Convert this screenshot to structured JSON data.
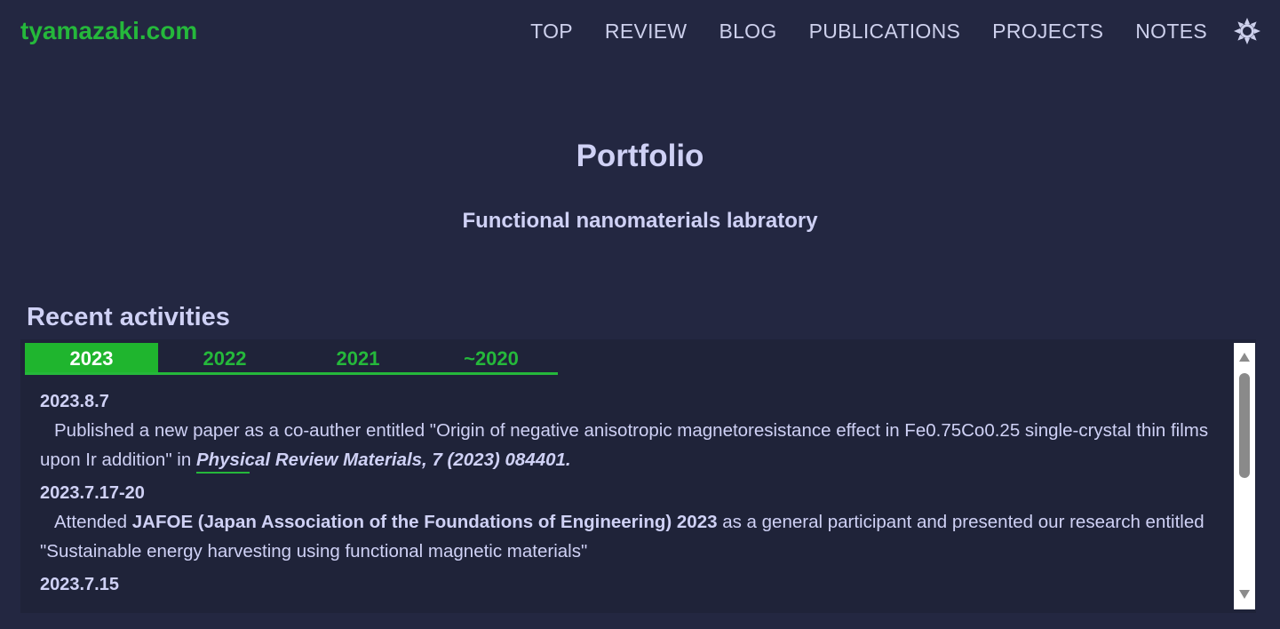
{
  "header": {
    "brand": "tyamazaki.com",
    "nav": [
      "TOP",
      "REVIEW",
      "BLOG",
      "PUBLICATIONS",
      "PROJECTS",
      "NOTES"
    ],
    "theme_icon": "sun-icon"
  },
  "hero": {
    "title": "Portfolio",
    "subtitle": "Functional nanomaterials labratory"
  },
  "activities": {
    "title": "Recent activities",
    "tabs": [
      "2023",
      "2022",
      "2021",
      "~2020"
    ],
    "active_tab": "2023",
    "entries": [
      {
        "date": "2023.8.7",
        "text_before": "Published a new paper as a co-auther entitled \"Origin of negative anisotropic magnetoresistance effect in Fe0.75Co0.25 single-crystal thin films upon Ir addition\" in ",
        "journal": "Physical Review Materials, 7 (2023) 084401."
      },
      {
        "date": "2023.7.17-20",
        "text_before": "Attended ",
        "event": "JAFOE (Japan Association of the Foundations of Engineering) 2023",
        "text_after": " as a general participant and presented our research entitled \"Sustainable energy harvesting using functional magnetic materials\""
      },
      {
        "date": "2023.7.15"
      }
    ]
  },
  "colors": {
    "background": "#232741",
    "accent": "#25b83b",
    "text": "#cfd1f5"
  }
}
